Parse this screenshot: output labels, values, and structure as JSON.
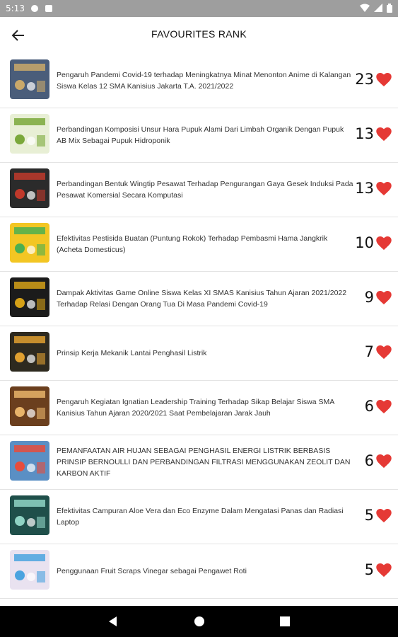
{
  "status_bar": {
    "time": "5:13"
  },
  "header": {
    "title": "FAVOURITES RANK"
  },
  "accent": "#e53935",
  "items": [
    {
      "title": "Pengaruh Pandemi Covid-19 terhadap Meningkatnya Minat Menonton Anime di Kalangan Siswa Kelas 12 SMA Kanisius Jakarta T.A. 2021/2022",
      "count": "23",
      "thumb_bg": "#4a5d7a",
      "thumb_accent": "#c9a86a"
    },
    {
      "title": "Perbandingan Komposisi Unsur Hara Pupuk Alami Dari Limbah Organik Dengan Pupuk AB Mix Sebagai Pupuk Hidroponik",
      "count": "13",
      "thumb_bg": "#e8efd5",
      "thumb_accent": "#7aa83a"
    },
    {
      "title": "Perbandingan Bentuk Wingtip Pesawat Terhadap Pengurangan Gaya Gesek Induksi Pada Pesawat Komersial Secara Komputasi",
      "count": "13",
      "thumb_bg": "#2b2b2b",
      "thumb_accent": "#c0392b"
    },
    {
      "title": "Efektivitas Pestisida Buatan (Puntung Rokok) Terhadap Pembasmi Hama Jangkrik (Acheta Domesticus)",
      "count": "10",
      "thumb_bg": "#f3c623",
      "thumb_accent": "#4caf50"
    },
    {
      "title": "Dampak Aktivitas Game Online Siswa Kelas XI SMAS Kanisius Tahun Ajaran 2021/2022 Terhadap Relasi Dengan Orang Tua Di Masa Pandemi Covid-19",
      "count": "9",
      "thumb_bg": "#1b1b1b",
      "thumb_accent": "#d4a017"
    },
    {
      "title": "Prinsip Kerja Mekanik Lantai Penghasil Listrik",
      "count": "7",
      "thumb_bg": "#2e2a1f",
      "thumb_accent": "#e0a030"
    },
    {
      "title": "Pengaruh Kegiatan Ignatian Leadership Training Terhadap Sikap Belajar Siswa SMA Kanisius Tahun Ajaran 2020/2021 Saat Pembelajaran Jarak Jauh",
      "count": "6",
      "thumb_bg": "#6b3f1e",
      "thumb_accent": "#e8b46a"
    },
    {
      "title": "PEMANFAATAN AIR HUJAN SEBAGAI PENGHASIL ENERGI LISTRIK BERBASIS PRINSIP BERNOULLI DAN PERBANDINGAN FILTRASI MENGGUNAKAN ZEOLIT DAN KARBON AKTIF",
      "count": "6",
      "thumb_bg": "#5a8fc4",
      "thumb_accent": "#e74c3c"
    },
    {
      "title": "Efektivitas Campuran Aloe Vera dan Eco Enzyme Dalam Mengatasi Panas dan Radiasi Laptop",
      "count": "5",
      "thumb_bg": "#1f4f4a",
      "thumb_accent": "#8fd3c4"
    },
    {
      "title": "Penggunaan Fruit Scraps Vinegar sebagai Pengawet Roti",
      "count": "5",
      "thumb_bg": "#e9e2f0",
      "thumb_accent": "#4aa3df"
    }
  ]
}
